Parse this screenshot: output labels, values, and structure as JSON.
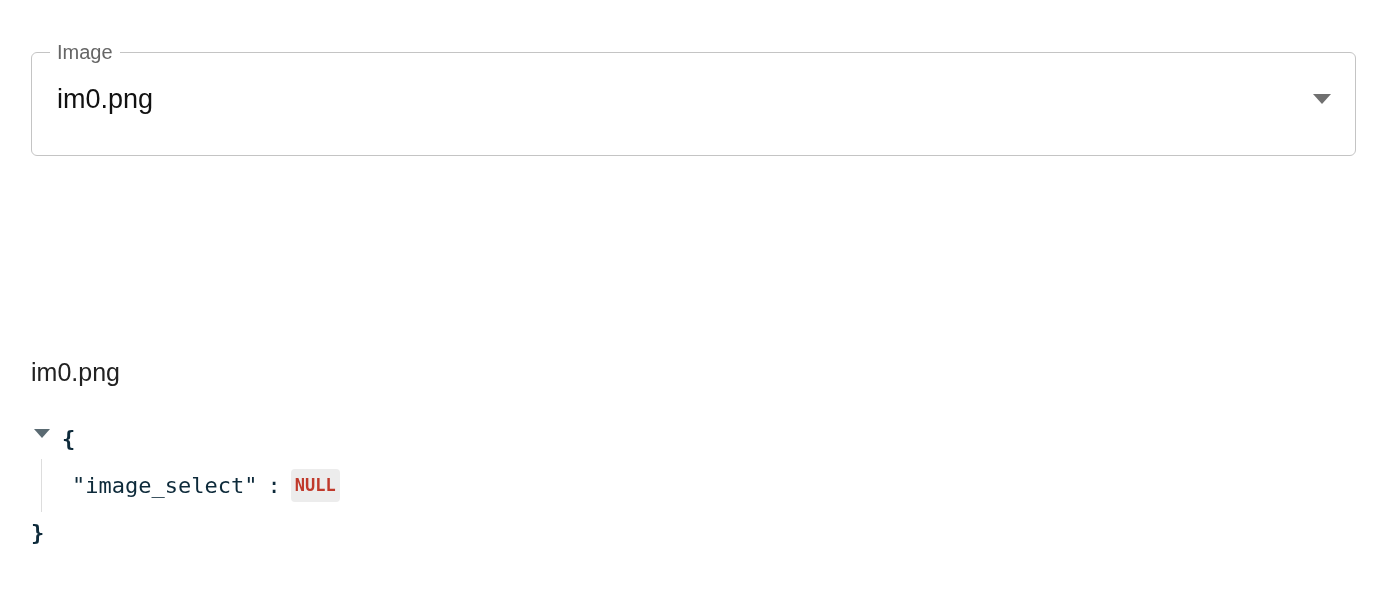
{
  "select": {
    "label": "Image",
    "value": "im0.png"
  },
  "caption": "im0.png",
  "json_view": {
    "expanded": true,
    "open_brace": "{",
    "close_brace": "}",
    "entries": [
      {
        "key": "\"image_select\"",
        "separator": ":",
        "value": "NULL"
      }
    ]
  }
}
